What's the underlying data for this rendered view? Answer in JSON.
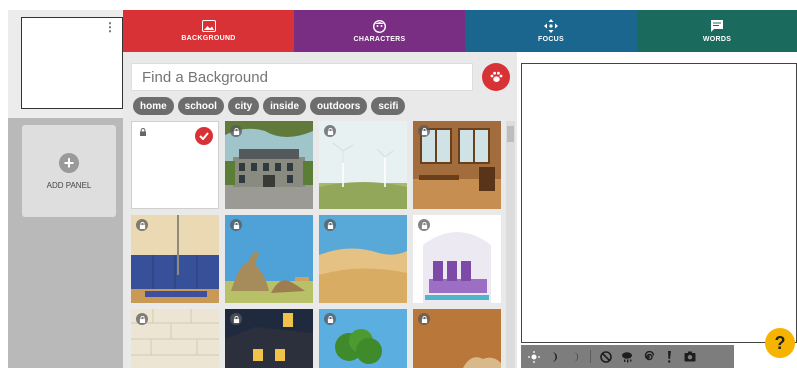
{
  "sidebar": {
    "add_panel_label": "ADD PANEL",
    "panel_menu_glyph": "⋮"
  },
  "tabs": [
    {
      "label": "BACKGROUND",
      "icon": "image-icon",
      "color": "#d93236",
      "active": true
    },
    {
      "label": "CHARACTERS",
      "icon": "face-icon",
      "color": "#7a2e83"
    },
    {
      "label": "FOCUS",
      "icon": "move-icon",
      "color": "#1a668e"
    },
    {
      "label": "WORDS",
      "icon": "speech-bubble-icon",
      "color": "#1b6a5e"
    }
  ],
  "search": {
    "placeholder": "Find a Background",
    "value": ""
  },
  "tags": [
    "home",
    "school",
    "city",
    "inside",
    "outdoors",
    "scifi"
  ],
  "backgrounds": [
    {
      "scene": "blank-white",
      "locked": true,
      "selected": true
    },
    {
      "scene": "mansion",
      "locked": true
    },
    {
      "scene": "wind-turbines",
      "locked": true
    },
    {
      "scene": "wooden-room",
      "locked": true
    },
    {
      "scene": "gym",
      "locked": true
    },
    {
      "scene": "dinosaurs",
      "locked": true
    },
    {
      "scene": "desert",
      "locked": true
    },
    {
      "scene": "purple-sofa",
      "locked": true
    },
    {
      "scene": "brick-wall",
      "locked": true
    },
    {
      "scene": "night-house",
      "locked": true
    },
    {
      "scene": "tree",
      "locked": true
    },
    {
      "scene": "brown-room",
      "locked": true
    }
  ],
  "toolbar": [
    "sun-icon",
    "moon-icon",
    "crescent-icon",
    "filter-icon",
    "storm-icon",
    "swirl-icon",
    "exclamation-icon",
    "camera-icon"
  ],
  "help": {
    "label": "?"
  },
  "colors": {
    "accent": "#d93236",
    "help": "#f6b400"
  }
}
